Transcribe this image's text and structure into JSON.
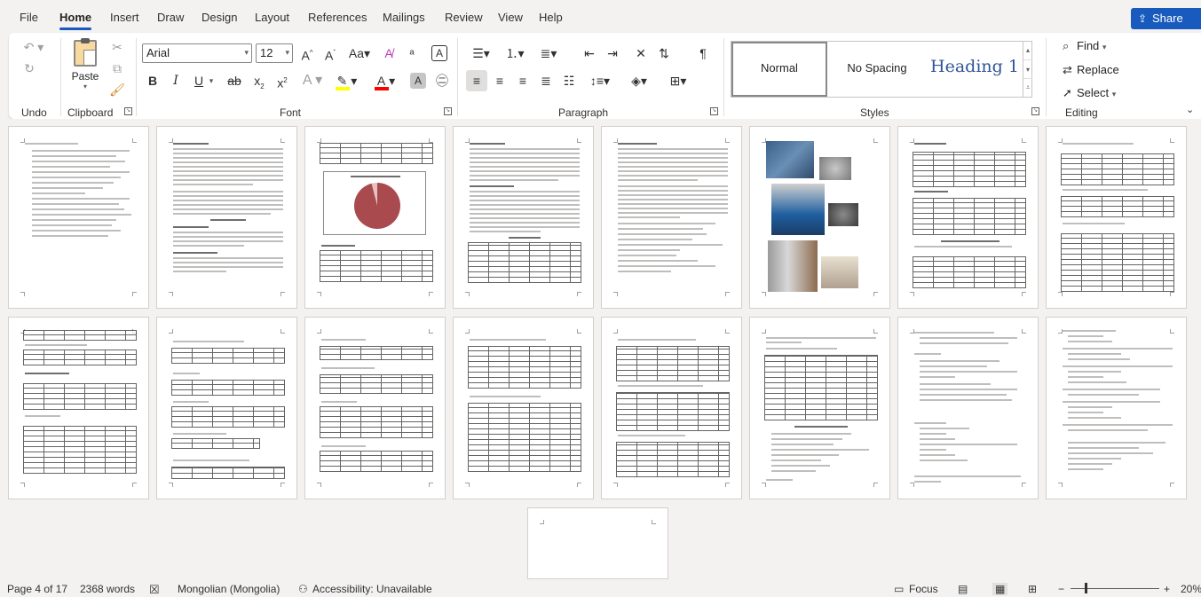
{
  "menu": {
    "tabs": [
      "File",
      "Home",
      "Insert",
      "Draw",
      "Design",
      "Layout",
      "References",
      "Mailings",
      "Review",
      "View",
      "Help"
    ],
    "active": "Home",
    "share_label": "Share"
  },
  "ribbon": {
    "undo": {
      "label": "Undo"
    },
    "clipboard": {
      "label": "Clipboard",
      "paste_label": "Paste"
    },
    "font": {
      "label": "Font",
      "font_name": "Arial",
      "font_size": "12"
    },
    "paragraph": {
      "label": "Paragraph"
    },
    "styles": {
      "label": "Styles",
      "items": [
        "Normal",
        "No Spacing",
        "Heading 1"
      ],
      "selected": "Normal"
    },
    "editing": {
      "label": "Editing",
      "find": "Find",
      "replace": "Replace",
      "select": "Select"
    }
  },
  "status": {
    "page": "Page 4 of 17",
    "words": "2368 words",
    "language": "Mongolian (Mongolia)",
    "accessibility": "Accessibility: Unavailable",
    "focus": "Focus",
    "zoom": "20%"
  },
  "colors": {
    "accent": "#185abd",
    "highlight": "#ffff00",
    "font_color": "#ff0000",
    "pie_slice": "#a94a4f"
  }
}
